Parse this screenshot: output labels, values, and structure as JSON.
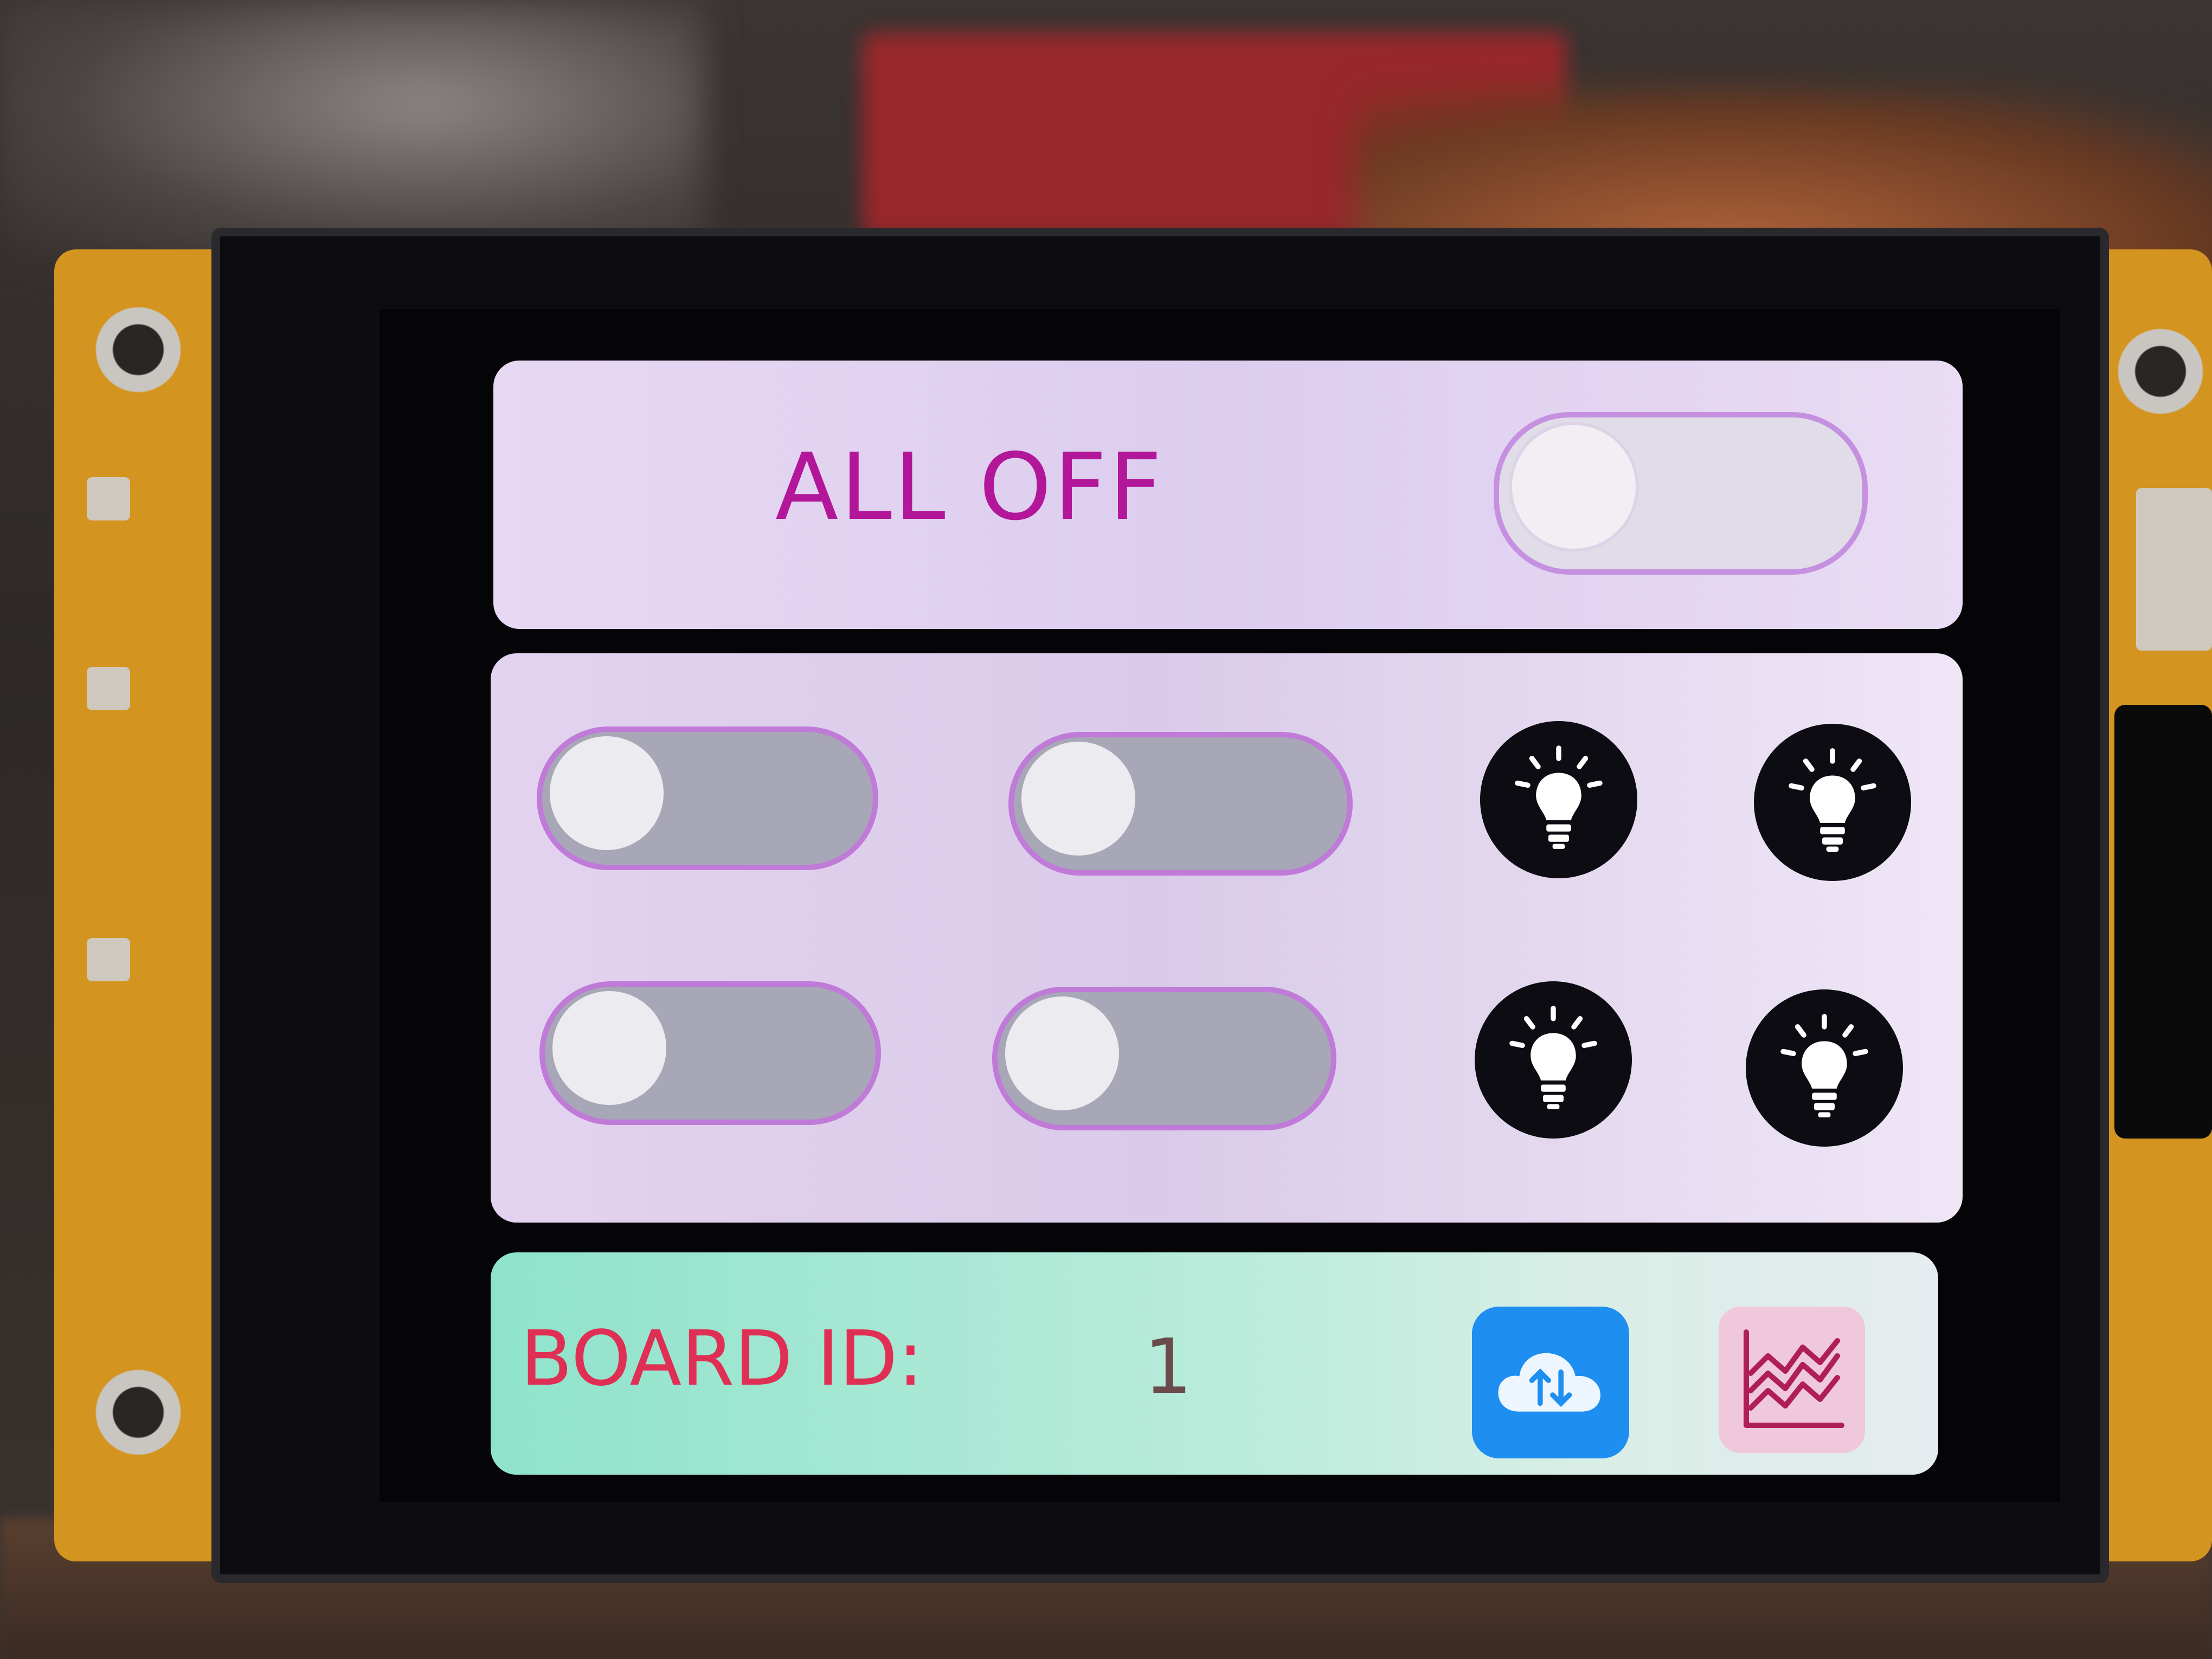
{
  "top": {
    "all_off_label": "ALL OFF",
    "all_off_toggle_state": "off"
  },
  "relays": {
    "toggles": [
      {
        "state": "off"
      },
      {
        "state": "off"
      },
      {
        "state": "off"
      },
      {
        "state": "off"
      }
    ],
    "bulb_icons": [
      "lightbulb-icon",
      "lightbulb-icon",
      "lightbulb-icon",
      "lightbulb-icon"
    ]
  },
  "bottom": {
    "board_id_label": "BOARD ID:",
    "board_id_value": "1",
    "cloud_icon": "cloud-sync-icon",
    "chart_icon": "chart-icon"
  },
  "colors": {
    "panel": "#e3d3f1",
    "accent_magenta": "#b2179a",
    "board_label": "#e02f55",
    "cloud_button": "#1e8ef0",
    "chart_button": "#efc8dc",
    "bottom_bar": "#9fe6cf"
  }
}
